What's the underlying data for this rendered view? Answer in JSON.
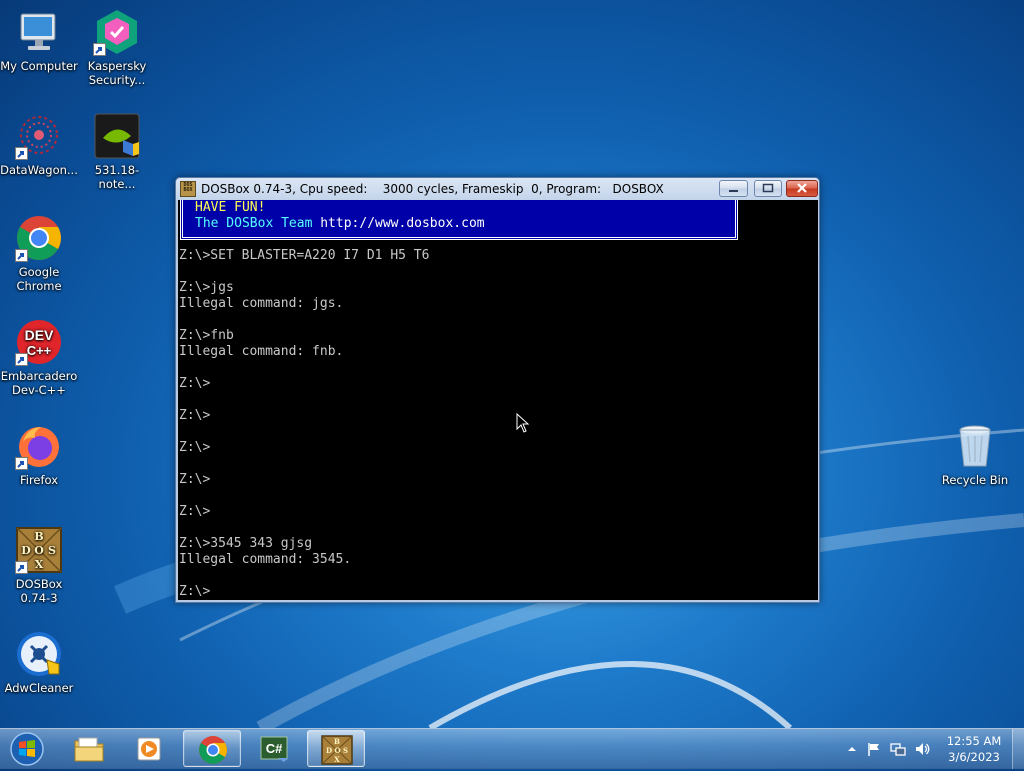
{
  "desktop": {
    "icons": [
      {
        "label": "My Computer",
        "icon": "my-computer-icon"
      },
      {
        "label": "Kaspersky Security...",
        "icon": "kaspersky-icon"
      },
      {
        "label": "DataWagon...",
        "icon": "datawagon-icon"
      },
      {
        "label": "531.18-note...",
        "icon": "nvidia-installer-icon"
      },
      {
        "label": "Google Chrome",
        "icon": "chrome-icon"
      },
      {
        "label": "Embarcadero Dev-C++",
        "icon": "devcpp-icon"
      },
      {
        "label": "Firefox",
        "icon": "firefox-icon"
      },
      {
        "label": "DOSBox 0.74-3",
        "icon": "dosbox-icon"
      },
      {
        "label": "AdwCleaner",
        "icon": "adwcleaner-icon"
      },
      {
        "label": "Recycle Bin",
        "icon": "recycle-bin-icon"
      }
    ]
  },
  "window": {
    "title": "DOSBox 0.74-3, Cpu speed:    3000 cycles, Frameskip  0, Program:   DOSBOX",
    "app_icon_text": "DOS BOX",
    "banner": {
      "line1": "HAVE FUN!",
      "line2_prefix": "The DOSBox Team ",
      "line2_url": "http://www.dosbox.com"
    },
    "console_lines": [
      "Z:\\>SET BLASTER=A220 I7 D1 H5 T6",
      "",
      "Z:\\>jgs",
      "Illegal command: jgs.",
      "",
      "Z:\\>fnb",
      "Illegal command: fnb.",
      "",
      "Z:\\>",
      "",
      "Z:\\>",
      "",
      "Z:\\>",
      "",
      "Z:\\>",
      "",
      "Z:\\>",
      "",
      "Z:\\>3545 343 gjsg",
      "Illegal command: 3545.",
      "",
      "Z:\\>"
    ]
  },
  "taskbar": {
    "items": [
      {
        "name": "file-explorer",
        "icon": "folder-icon",
        "open": false
      },
      {
        "name": "media-player",
        "icon": "media-player-icon",
        "open": false
      },
      {
        "name": "google-chrome",
        "icon": "chrome-icon",
        "open": true
      },
      {
        "name": "csharp-app",
        "icon": "csharp-icon",
        "open": false
      },
      {
        "name": "dosbox",
        "icon": "dosbox-icon",
        "open": true
      }
    ],
    "clock": {
      "time": "12:55 AM",
      "date": "3/6/2023"
    }
  }
}
